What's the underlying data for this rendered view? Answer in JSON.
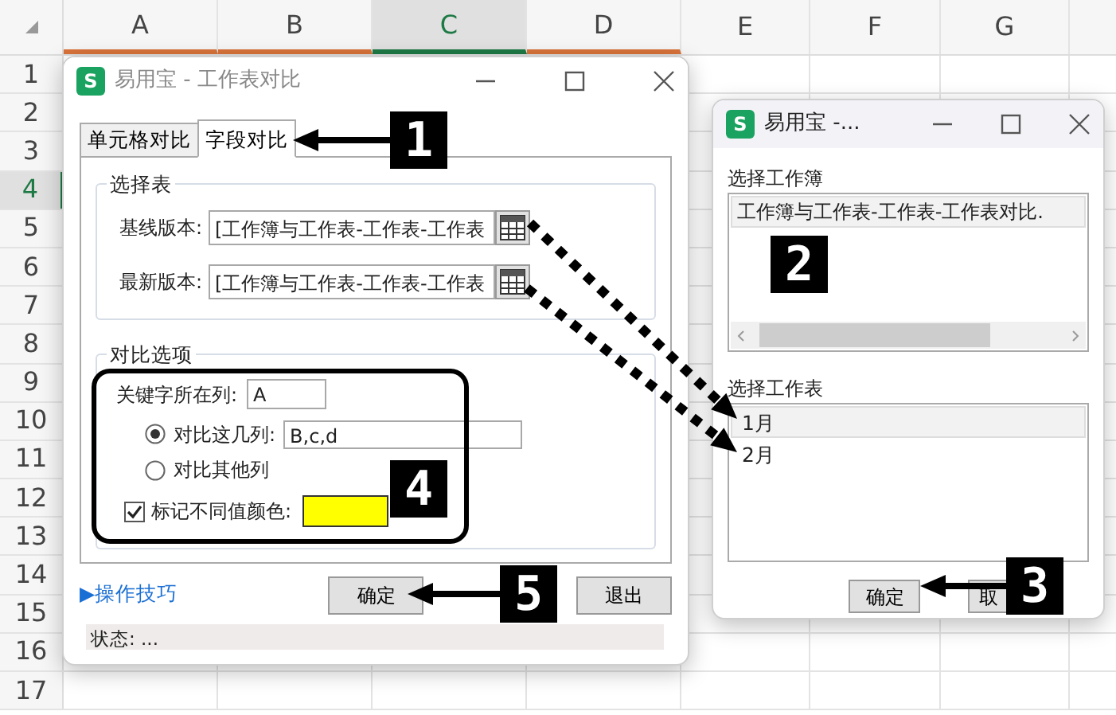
{
  "spreadsheet": {
    "columns": [
      {
        "label": "A",
        "selected": false
      },
      {
        "label": "B",
        "selected": false
      },
      {
        "label": "C",
        "selected": true
      },
      {
        "label": "D",
        "selected": false
      },
      {
        "label": "E",
        "selected": false
      },
      {
        "label": "F",
        "selected": false
      },
      {
        "label": "G",
        "selected": false
      }
    ],
    "rows": [
      {
        "label": "1",
        "selected": false
      },
      {
        "label": "2",
        "selected": false
      },
      {
        "label": "3",
        "selected": false
      },
      {
        "label": "4",
        "selected": true
      },
      {
        "label": "5",
        "selected": false
      },
      {
        "label": "6",
        "selected": false
      },
      {
        "label": "7",
        "selected": false
      },
      {
        "label": "8",
        "selected": false
      },
      {
        "label": "9",
        "selected": false
      },
      {
        "label": "10",
        "selected": false
      },
      {
        "label": "11",
        "selected": false
      },
      {
        "label": "12",
        "selected": false
      },
      {
        "label": "13",
        "selected": false
      },
      {
        "label": "14",
        "selected": false
      },
      {
        "label": "15",
        "selected": false
      },
      {
        "label": "16",
        "selected": false
      },
      {
        "label": "17",
        "selected": false
      }
    ]
  },
  "main_dialog": {
    "app_icon_letter": "S",
    "title": "易用宝 - 工作表对比",
    "tabs": [
      {
        "label": "单元格对比",
        "selected": false
      },
      {
        "label": "字段对比",
        "selected": true
      }
    ],
    "select_group": {
      "title": "选择表",
      "fields": [
        {
          "label": "基线版本:",
          "value": "[工作簿与工作表-工作表-工作表"
        },
        {
          "label": "最新版本:",
          "value": "[工作簿与工作表-工作表-工作表"
        }
      ]
    },
    "options_group": {
      "title": "对比选项",
      "key_column": {
        "label": "关键字所在列:",
        "value": "A"
      },
      "radios": [
        {
          "label": "对比这几列:",
          "selected": true,
          "value": "B,c,d"
        },
        {
          "label": "对比其他列",
          "selected": false
        }
      ],
      "mark_color": {
        "label": "标记不同值颜色:",
        "checked": true,
        "color": "#ffff00"
      }
    },
    "tips_link": "▶操作技巧",
    "buttons": [
      "确定",
      "退出"
    ],
    "status": "状态: ..."
  },
  "picker_dialog": {
    "app_icon_letter": "S",
    "title": "易用宝 -...",
    "workbook_label": "选择工作簿",
    "workbooks": [
      {
        "label": "工作簿与工作表-工作表-工作表对比.",
        "selected": true
      }
    ],
    "sheet_label": "选择工作表",
    "sheets": [
      {
        "label": "1月",
        "selected": true
      },
      {
        "label": "2月",
        "selected": false
      }
    ],
    "buttons": [
      "确定",
      "取"
    ]
  },
  "annotations": [
    {
      "label": "1"
    },
    {
      "label": "2"
    },
    {
      "label": "3"
    },
    {
      "label": "4"
    },
    {
      "label": "5"
    }
  ]
}
